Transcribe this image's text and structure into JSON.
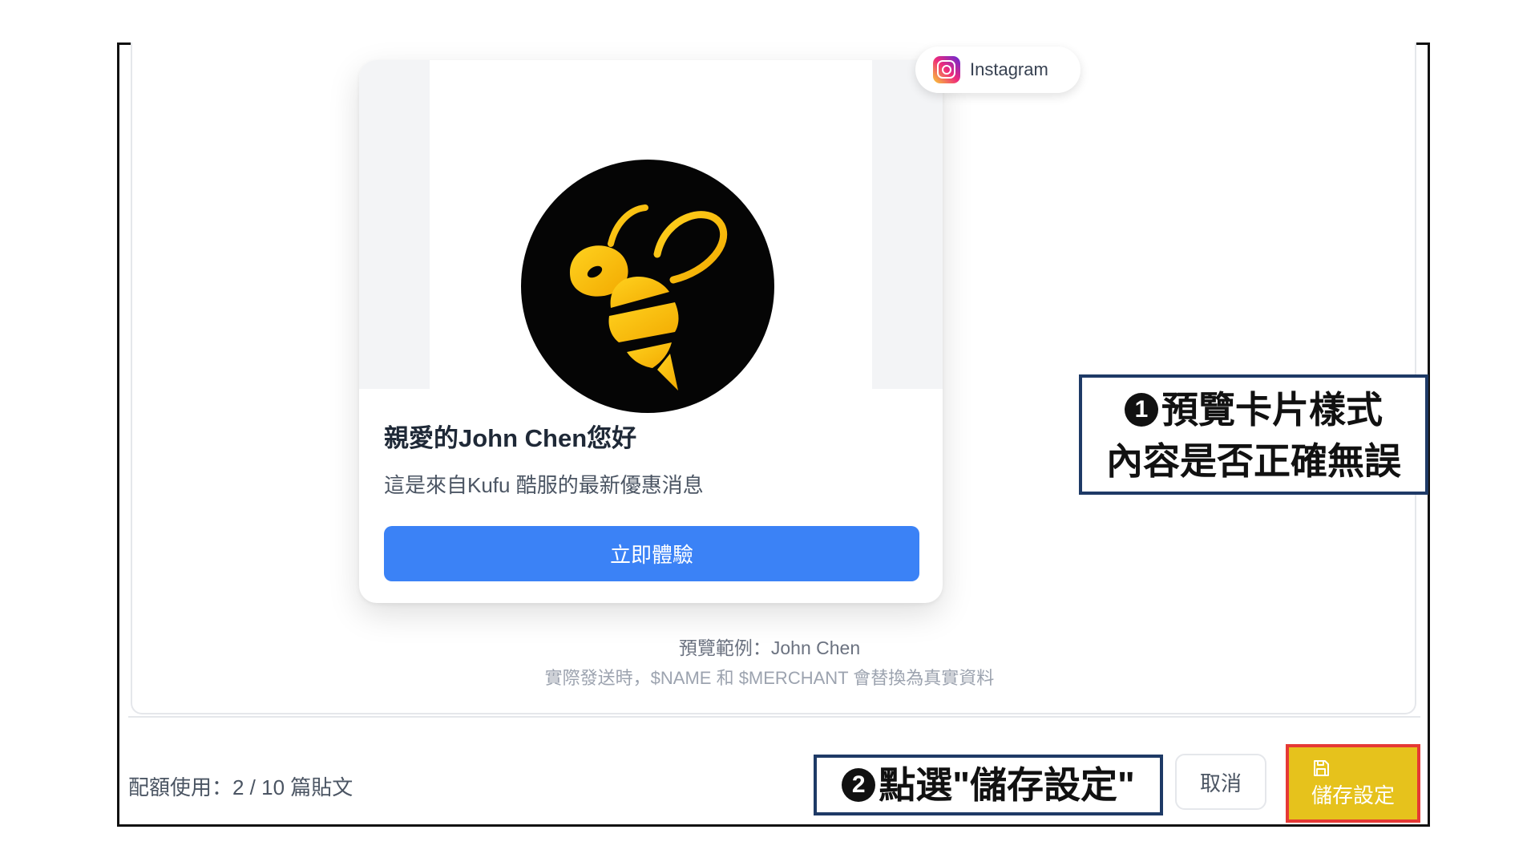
{
  "preview": {
    "platform_label": "Instagram",
    "card": {
      "title": "親愛的John Chen您好",
      "body": "這是來自Kufu 酷服的最新優惠消息",
      "cta_label": "立即體驗",
      "logo": "bee-logo"
    },
    "caption_sample": "預覽範例：John Chen",
    "caption_note": "實際發送時，$NAME 和 $MERCHANT 會替換為真實資料"
  },
  "footer": {
    "quota_text": "配額使用：2 / 10 篇貼文",
    "cancel_label": "取消",
    "save_label": "儲存設定",
    "save_icon": "floppy-disk-icon"
  },
  "annotations": {
    "step1_number": "1",
    "step1_line1": "預覽卡片樣式",
    "step1_line2": "內容是否正確無誤",
    "step2_number": "2",
    "step2_text": "點選\"儲存設定\""
  },
  "colors": {
    "cta": "#3b82f6",
    "save_button": "#e6c21c",
    "save_highlight": "#e53935",
    "callout_border": "#1e3a66"
  }
}
